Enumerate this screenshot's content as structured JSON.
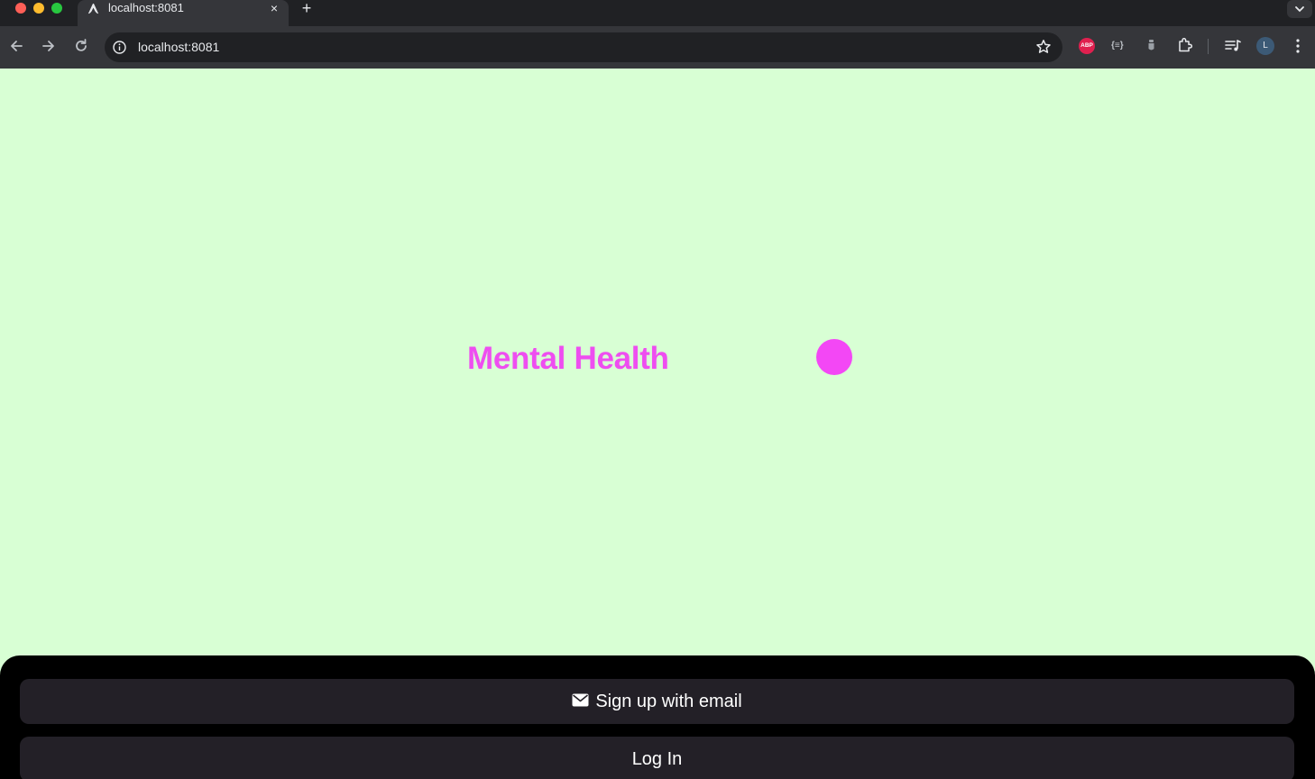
{
  "browser": {
    "tab": {
      "title": "localhost:8081"
    },
    "new_tab_symbol": "+",
    "tab_close_symbol": "×",
    "address_bar": {
      "url": "localhost:8081"
    },
    "extensions": {
      "adblock_label": "ABP",
      "braces_label": "{≡}",
      "profile_initial": "L"
    }
  },
  "app": {
    "title": "Mental Health",
    "accent_color": "#f347f5",
    "background_color": "#d8ffd4",
    "buttons": {
      "signup_label": "Sign up with email",
      "login_label": "Log In"
    }
  }
}
